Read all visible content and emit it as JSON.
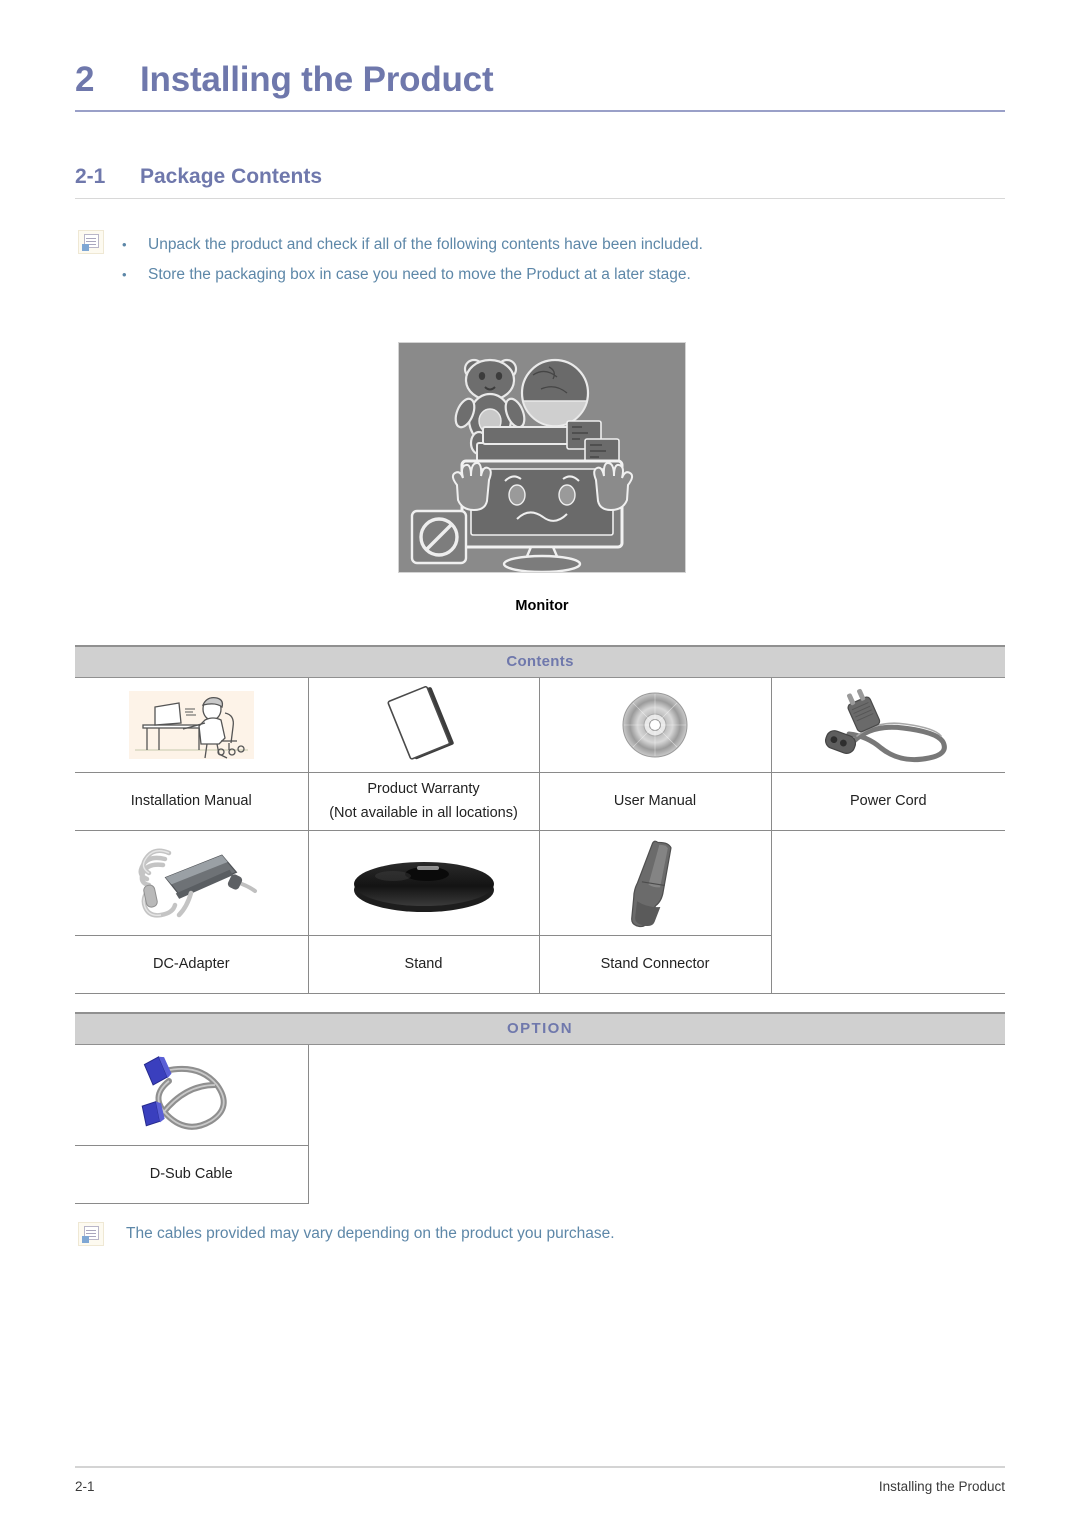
{
  "chapter": {
    "number": "2",
    "title": "Installing the Product"
  },
  "section": {
    "number": "2-1",
    "title": "Package Contents"
  },
  "notes_top": {
    "icon": "note-memo-icon",
    "bullet_char": "•",
    "items": [
      "Unpack the product and check if all of the following contents have been included.",
      "Store the packaging box in case you need to move the Product at a later stage."
    ]
  },
  "hero": {
    "illustration_name": "monitor-warning-illustration",
    "caption": "Monitor"
  },
  "contents_table": {
    "header": "Contents",
    "rows": [
      [
        {
          "icon": "installation-manual-icon",
          "label": "Installation Manual"
        },
        {
          "icon": "product-warranty-icon",
          "label": "Product Warranty\n(Not available in all locations)"
        },
        {
          "icon": "cd-disc-icon",
          "label": "User Manual"
        },
        {
          "icon": "power-cord-icon",
          "label": "Power Cord"
        }
      ],
      [
        {
          "icon": "dc-adapter-icon",
          "label": "DC-Adapter"
        },
        {
          "icon": "stand-base-icon",
          "label": "Stand"
        },
        {
          "icon": "stand-connector-icon",
          "label": "Stand Connector"
        },
        {
          "icon": "",
          "label": ""
        }
      ]
    ]
  },
  "option_table": {
    "header": "OPTION",
    "rows": [
      [
        {
          "icon": "d-sub-cable-icon",
          "label": "D-Sub Cable"
        },
        {
          "icon": "",
          "label": ""
        }
      ]
    ]
  },
  "note_bottom": {
    "icon": "note-memo-icon",
    "text": "The cables provided may vary depending on the product you purchase."
  },
  "footer": {
    "left": "2-1",
    "right": "Installing the Product"
  },
  "colors": {
    "heading_purple": "#6f78ac",
    "note_blue": "#5d87a8",
    "table_header_bg": "#d0d0d0",
    "hero_bg": "#8a8a8a",
    "border_gray": "#8a8a8a"
  }
}
